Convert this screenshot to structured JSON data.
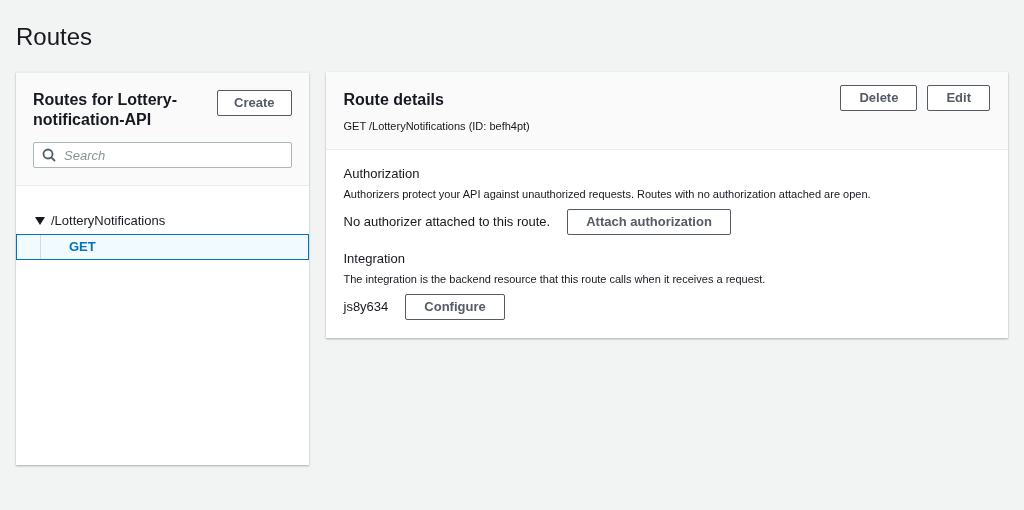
{
  "page_title": "Routes",
  "routes_panel": {
    "title": "Routes for Lottery-notification-API",
    "create_button": "Create",
    "search": {
      "placeholder": "Search"
    },
    "tree": [
      {
        "label": "/LotteryNotifications",
        "expanded": true,
        "selected": false,
        "children": [
          {
            "label": "GET",
            "selected": true
          }
        ]
      }
    ]
  },
  "details": {
    "title": "Route details",
    "subtitle": "GET /LotteryNotifications (ID: befh4pt)",
    "buttons": [
      "Delete",
      "Edit"
    ],
    "sections": [
      {
        "heading": "Authorization",
        "description": "Authorizers protect your API against unauthorized requests. Routes with no authorization attached are open.",
        "value": "No authorizer attached to this route.",
        "button": "Attach authorization"
      },
      {
        "heading": "Integration",
        "description": "The integration is the backend resource that this route calls when it receives a request.",
        "value": "js8y634",
        "button": "Configure"
      }
    ]
  }
}
